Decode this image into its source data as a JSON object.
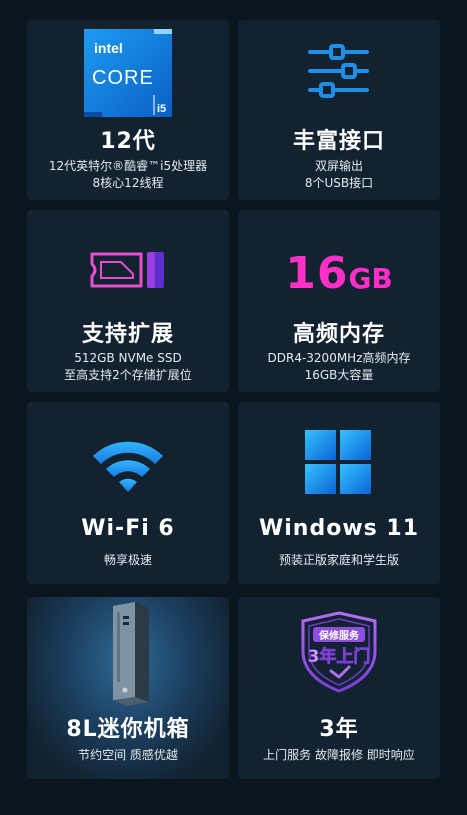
{
  "cards": [
    {
      "title": "12代",
      "lines": [
        "12代英特尔®酷睿™i5处理器",
        "8核心12线程"
      ],
      "icon": "intel-core-i5-logo",
      "logo": {
        "brand": "intel",
        "line": "CORE",
        "tier": "i5"
      }
    },
    {
      "title": "丰富接口",
      "lines": [
        "双屏输出",
        "8个USB接口"
      ],
      "icon": "sliders-icon"
    },
    {
      "title": "支持扩展",
      "lines": [
        "512GB NVMe SSD",
        "至高支持2个存储扩展位"
      ],
      "icon": "ssd-icon"
    },
    {
      "title": "高频内存",
      "lines": [
        "DDR4-3200MHz高频内存",
        "16GB大容量"
      ],
      "icon": "memory-capacity-graphic",
      "capacity_number": "16",
      "capacity_unit": "GB"
    },
    {
      "title": "Wi-Fi 6",
      "lines": [
        "畅享极速"
      ],
      "icon": "wifi-icon"
    },
    {
      "title": "Windows 11",
      "lines": [
        "预装正版家庭和学生版"
      ],
      "icon": "windows-logo-icon"
    },
    {
      "title": "8L迷你机箱",
      "lines": [
        "节约空间 质感优越"
      ],
      "icon": "mini-pc-case-image"
    },
    {
      "title": "3年",
      "lines": [
        "上门服务 故障报修 即时响应"
      ],
      "icon": "warranty-shield-badge",
      "badge": {
        "top": "保修服务",
        "main": "3年上门"
      }
    }
  ],
  "colors": {
    "page_bg": "#0b151d",
    "card_bg": "#122230",
    "accent_blue": "#1c8fe8",
    "accent_magenta": "#e64fd0",
    "ram_pink": "#ff2fc8",
    "badge_purple": "#a45be8"
  }
}
